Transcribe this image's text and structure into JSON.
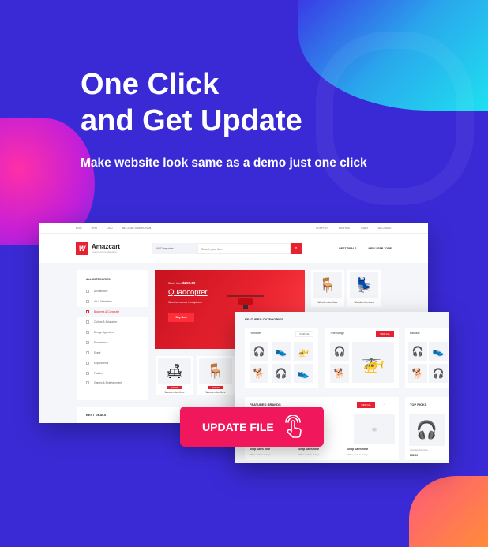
{
  "headline": {
    "line1": "One Click",
    "line2": "and Get Update",
    "subtitle": "Make website look same as a demo just one click"
  },
  "colors": {
    "background": "#3a2ad6",
    "accent": "#e7212f",
    "button": "#f0175d"
  },
  "site": {
    "topbar": {
      "left": [
        "ENG",
        "RHD",
        "USD",
        "BECOME A MERCHANT"
      ],
      "right": [
        "SUPPORT",
        "WISHLIST",
        "CART",
        "ACCOUNT"
      ]
    },
    "brand": "Amazcart",
    "tagline": "Live on online shopping",
    "logo_letter": "W",
    "category_select": "All Categories",
    "search_placeholder": "Search your item",
    "nav": [
      "BEST DEALS",
      "NEW USER ZONE"
    ],
    "sidebar": {
      "title": "ALL CATEGORIES",
      "items": [
        "Architecture",
        "Art & Illustration",
        "Business & Corporate",
        "Culture & Education",
        "Design Agencies",
        "Ecommerce",
        "Event",
        "Experiments",
        "Fashion",
        "Games & Entertainment"
      ],
      "active": 2
    },
    "hero": {
      "price_prefix": "Starts from",
      "price": "$259.00",
      "title": "Quadcopter",
      "desc": "Wireless on-ear headphone",
      "button": "Buy Now"
    },
    "products": [
      {
        "name": "Wooden furniture",
        "price": "$33.00"
      },
      {
        "name": "Wooden furniture",
        "price": "$33.00"
      }
    ],
    "top_products": [
      {
        "name": "Wooden furniture"
      },
      {
        "name": "Wooden furniture"
      }
    ],
    "best_deals": "BEST DEALS"
  },
  "site2": {
    "featured_categories": "FEATURED CATEGORIES",
    "cards": [
      {
        "title": "Furniture",
        "button": "VIEW ALL"
      },
      {
        "title": "Technology",
        "button": "VIEW ALL"
      },
      {
        "title": "Fashion"
      }
    ],
    "featured_brands": "FEATURED BRANDS",
    "brands_button": "VIEW ALL",
    "brands": [
      {
        "title": "Shop Sales now!",
        "sub": "Offer ends in 2 days"
      },
      {
        "title": "Shop Sales now!",
        "sub": "Offer ends in 2 days"
      },
      {
        "title": "Shop Sales now!",
        "sub": "Offer ends in 2 days"
      }
    ],
    "top_picks": "TOP PICKS",
    "top_pick_item": {
      "name": "Wooden furniture",
      "price": "$55.00"
    }
  },
  "update_button": "UPDATE FILE"
}
